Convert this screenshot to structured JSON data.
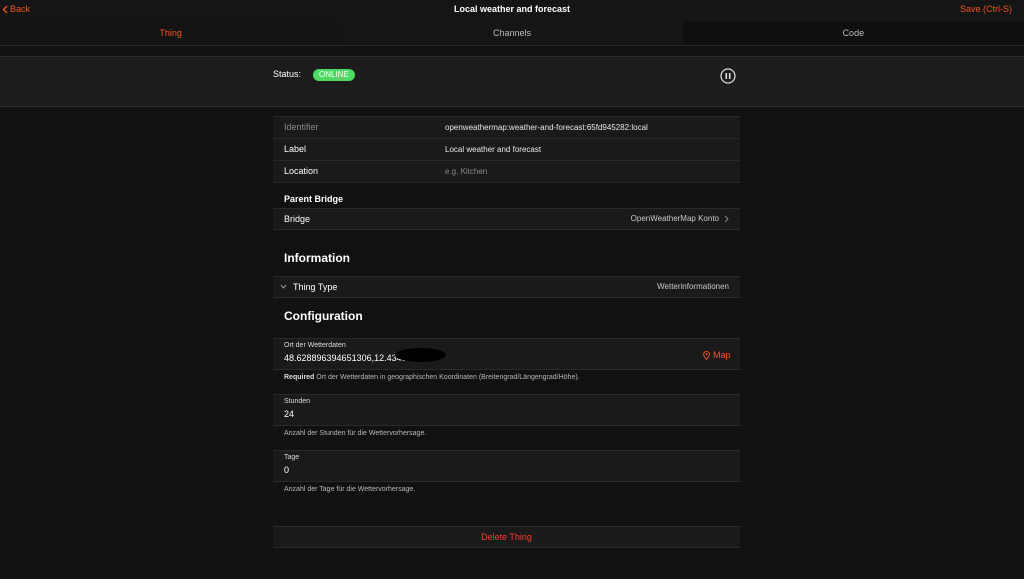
{
  "nav": {
    "back_label": "Back",
    "title": "Local weather and forecast",
    "save_label": "Save (Ctrl-S)"
  },
  "tabs": [
    {
      "label": "Thing"
    },
    {
      "label": "Channels"
    },
    {
      "label": "Code"
    }
  ],
  "status": {
    "label": "Status:",
    "badge": "ONLINE",
    "badge_color": "#4cd964"
  },
  "details": {
    "identifier_label": "Identifier",
    "identifier_value": "openweathermap:weather-and-forecast:65fd945282:local",
    "label_label": "Label",
    "label_value": "Local weather and forecast",
    "location_label": "Location",
    "location_placeholder": "e.g. Kitchen"
  },
  "bridge": {
    "heading": "Parent Bridge",
    "label": "Bridge",
    "value": "OpenWeatherMap Konto"
  },
  "information": {
    "heading": "Information",
    "thing_type_label": "Thing Type",
    "thing_type_value": "Wetterinformationen"
  },
  "configuration": {
    "heading": "Configuration",
    "location_label": "Ort der Wetterdaten",
    "location_value": "48.628896394651306,12.4349",
    "map_label": "Map",
    "location_required": "Required",
    "location_hint": "Ort der Wetterdaten in geographischen Koordinaten (Breitengrad/Längengrad/Höhe).",
    "hours_label": "Stunden",
    "hours_value": "24",
    "hours_hint": "Anzahl der Stunden für die Wettervorhersage.",
    "days_label": "Tage",
    "days_value": "0",
    "days_hint": "Anzahl der Tage für die Wettervorhersage."
  },
  "delete_label": "Delete Thing",
  "colors": {
    "accent": "#f2541f",
    "danger": "#ff3b30",
    "background": "#111111"
  },
  "icons": [
    "chevron-left-icon",
    "pause-icon",
    "chevron-right-icon",
    "chevron-down-icon",
    "map-pin-icon"
  ]
}
